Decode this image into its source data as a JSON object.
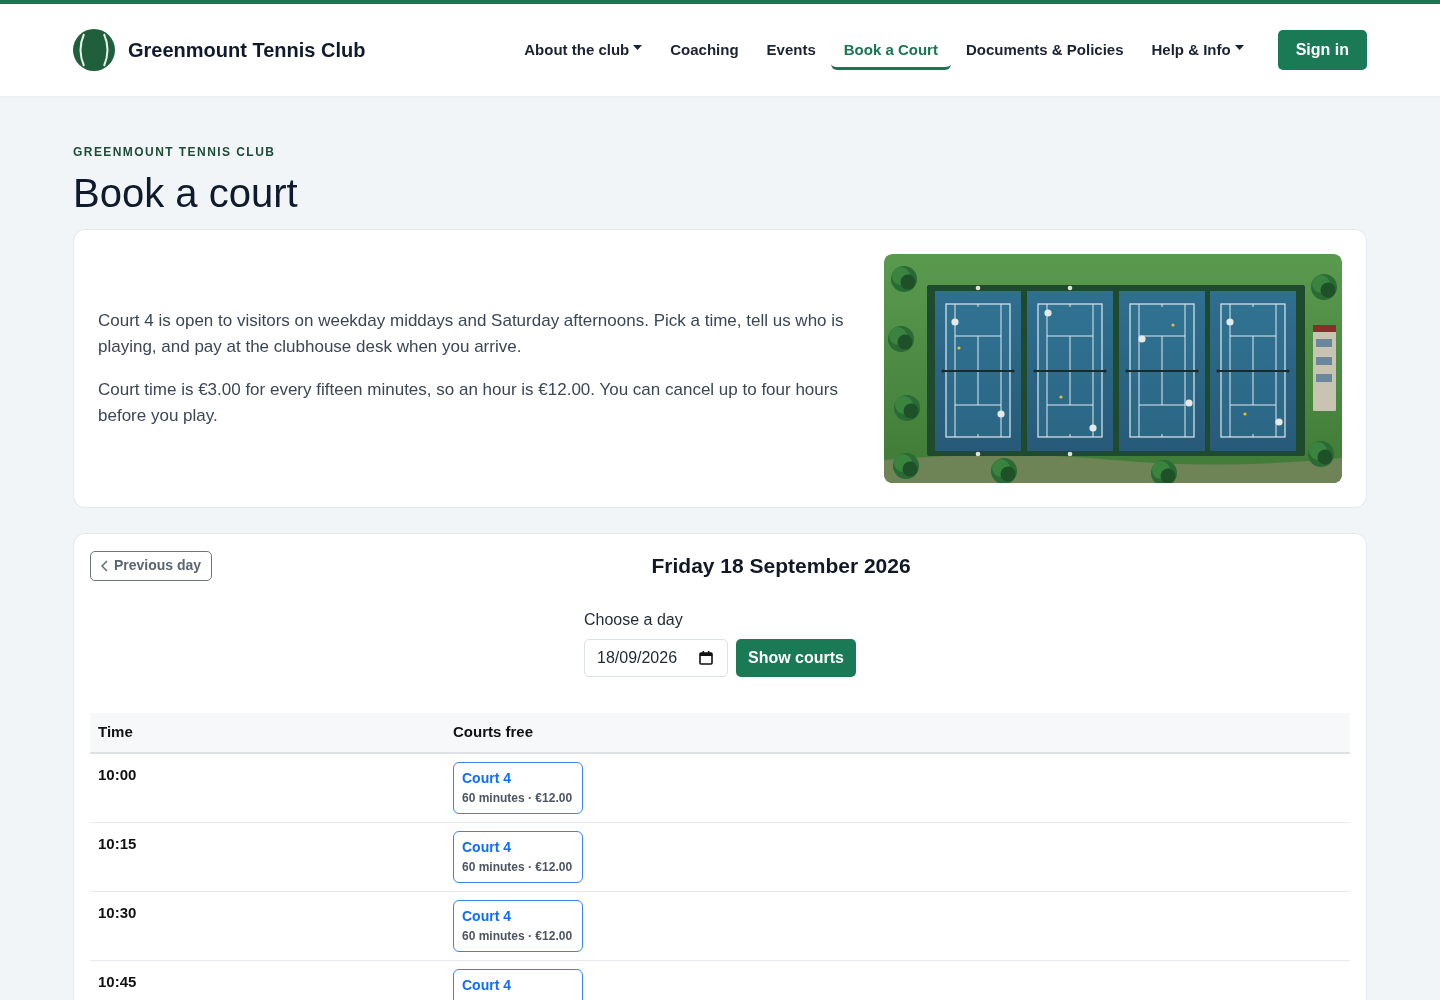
{
  "nav": {
    "brand": "Greenmount Tennis Club",
    "items": [
      {
        "label": "About the club",
        "dropdown": true,
        "selected": false
      },
      {
        "label": "Coaching",
        "dropdown": false,
        "selected": false
      },
      {
        "label": "Events",
        "dropdown": false,
        "selected": false
      },
      {
        "label": "Book a Court",
        "dropdown": false,
        "selected": true
      },
      {
        "label": "Documents & Policies",
        "dropdown": false,
        "selected": false
      },
      {
        "label": "Help & Info",
        "dropdown": true,
        "selected": false
      }
    ],
    "sign_in": "Sign in"
  },
  "page": {
    "eyebrow": "GREENMOUNT TENNIS CLUB",
    "title": "Book a court"
  },
  "intro": {
    "paragraphs": [
      "Court 4 is open to visitors on weekday middays and Saturday afternoons. Pick a time, tell us who is playing, and pay at the clubhouse desk when you arrive.",
      "Court time is €3.00 for every fifteen minutes, so an hour is €12.00. You can cancel up to four hours before you play."
    ]
  },
  "booking": {
    "previous_day": "Previous day",
    "date_title": "Friday 18 September 2026",
    "date_label": "Choose a day",
    "date_value": "18/09/2026",
    "submit": "Show courts"
  },
  "table": {
    "columns": [
      "Time",
      "Courts free"
    ],
    "rows": [
      {
        "time": "10:00",
        "slots": [
          {
            "court": "Court 4",
            "detail": "60 minutes · €12.00"
          }
        ]
      },
      {
        "time": "10:15",
        "slots": [
          {
            "court": "Court 4",
            "detail": "60 minutes · €12.00"
          }
        ]
      },
      {
        "time": "10:30",
        "slots": [
          {
            "court": "Court 4",
            "detail": "60 minutes · €12.00"
          }
        ]
      },
      {
        "time": "10:45",
        "slots": [
          {
            "court": "Court 4"
          }
        ]
      }
    ]
  }
}
